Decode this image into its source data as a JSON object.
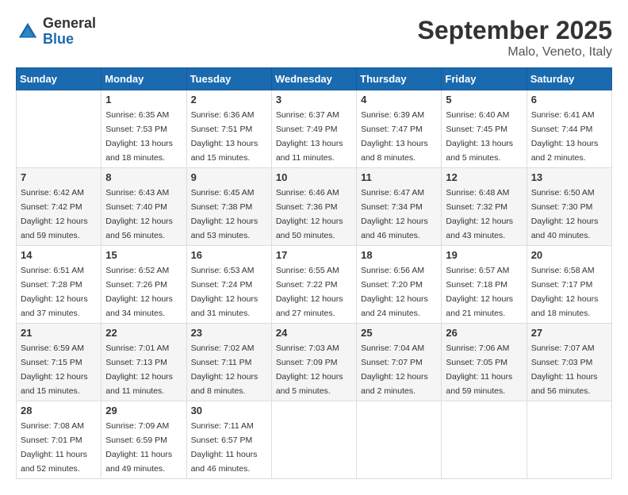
{
  "logo": {
    "general": "General",
    "blue": "Blue"
  },
  "title": "September 2025",
  "subtitle": "Malo, Veneto, Italy",
  "weekdays": [
    "Sunday",
    "Monday",
    "Tuesday",
    "Wednesday",
    "Thursday",
    "Friday",
    "Saturday"
  ],
  "weeks": [
    [
      {
        "day": "",
        "info": ""
      },
      {
        "day": "1",
        "info": "Sunrise: 6:35 AM\nSunset: 7:53 PM\nDaylight: 13 hours\nand 18 minutes."
      },
      {
        "day": "2",
        "info": "Sunrise: 6:36 AM\nSunset: 7:51 PM\nDaylight: 13 hours\nand 15 minutes."
      },
      {
        "day": "3",
        "info": "Sunrise: 6:37 AM\nSunset: 7:49 PM\nDaylight: 13 hours\nand 11 minutes."
      },
      {
        "day": "4",
        "info": "Sunrise: 6:39 AM\nSunset: 7:47 PM\nDaylight: 13 hours\nand 8 minutes."
      },
      {
        "day": "5",
        "info": "Sunrise: 6:40 AM\nSunset: 7:45 PM\nDaylight: 13 hours\nand 5 minutes."
      },
      {
        "day": "6",
        "info": "Sunrise: 6:41 AM\nSunset: 7:44 PM\nDaylight: 13 hours\nand 2 minutes."
      }
    ],
    [
      {
        "day": "7",
        "info": "Sunrise: 6:42 AM\nSunset: 7:42 PM\nDaylight: 12 hours\nand 59 minutes."
      },
      {
        "day": "8",
        "info": "Sunrise: 6:43 AM\nSunset: 7:40 PM\nDaylight: 12 hours\nand 56 minutes."
      },
      {
        "day": "9",
        "info": "Sunrise: 6:45 AM\nSunset: 7:38 PM\nDaylight: 12 hours\nand 53 minutes."
      },
      {
        "day": "10",
        "info": "Sunrise: 6:46 AM\nSunset: 7:36 PM\nDaylight: 12 hours\nand 50 minutes."
      },
      {
        "day": "11",
        "info": "Sunrise: 6:47 AM\nSunset: 7:34 PM\nDaylight: 12 hours\nand 46 minutes."
      },
      {
        "day": "12",
        "info": "Sunrise: 6:48 AM\nSunset: 7:32 PM\nDaylight: 12 hours\nand 43 minutes."
      },
      {
        "day": "13",
        "info": "Sunrise: 6:50 AM\nSunset: 7:30 PM\nDaylight: 12 hours\nand 40 minutes."
      }
    ],
    [
      {
        "day": "14",
        "info": "Sunrise: 6:51 AM\nSunset: 7:28 PM\nDaylight: 12 hours\nand 37 minutes."
      },
      {
        "day": "15",
        "info": "Sunrise: 6:52 AM\nSunset: 7:26 PM\nDaylight: 12 hours\nand 34 minutes."
      },
      {
        "day": "16",
        "info": "Sunrise: 6:53 AM\nSunset: 7:24 PM\nDaylight: 12 hours\nand 31 minutes."
      },
      {
        "day": "17",
        "info": "Sunrise: 6:55 AM\nSunset: 7:22 PM\nDaylight: 12 hours\nand 27 minutes."
      },
      {
        "day": "18",
        "info": "Sunrise: 6:56 AM\nSunset: 7:20 PM\nDaylight: 12 hours\nand 24 minutes."
      },
      {
        "day": "19",
        "info": "Sunrise: 6:57 AM\nSunset: 7:18 PM\nDaylight: 12 hours\nand 21 minutes."
      },
      {
        "day": "20",
        "info": "Sunrise: 6:58 AM\nSunset: 7:17 PM\nDaylight: 12 hours\nand 18 minutes."
      }
    ],
    [
      {
        "day": "21",
        "info": "Sunrise: 6:59 AM\nSunset: 7:15 PM\nDaylight: 12 hours\nand 15 minutes."
      },
      {
        "day": "22",
        "info": "Sunrise: 7:01 AM\nSunset: 7:13 PM\nDaylight: 12 hours\nand 11 minutes."
      },
      {
        "day": "23",
        "info": "Sunrise: 7:02 AM\nSunset: 7:11 PM\nDaylight: 12 hours\nand 8 minutes."
      },
      {
        "day": "24",
        "info": "Sunrise: 7:03 AM\nSunset: 7:09 PM\nDaylight: 12 hours\nand 5 minutes."
      },
      {
        "day": "25",
        "info": "Sunrise: 7:04 AM\nSunset: 7:07 PM\nDaylight: 12 hours\nand 2 minutes."
      },
      {
        "day": "26",
        "info": "Sunrise: 7:06 AM\nSunset: 7:05 PM\nDaylight: 11 hours\nand 59 minutes."
      },
      {
        "day": "27",
        "info": "Sunrise: 7:07 AM\nSunset: 7:03 PM\nDaylight: 11 hours\nand 56 minutes."
      }
    ],
    [
      {
        "day": "28",
        "info": "Sunrise: 7:08 AM\nSunset: 7:01 PM\nDaylight: 11 hours\nand 52 minutes."
      },
      {
        "day": "29",
        "info": "Sunrise: 7:09 AM\nSunset: 6:59 PM\nDaylight: 11 hours\nand 49 minutes."
      },
      {
        "day": "30",
        "info": "Sunrise: 7:11 AM\nSunset: 6:57 PM\nDaylight: 11 hours\nand 46 minutes."
      },
      {
        "day": "",
        "info": ""
      },
      {
        "day": "",
        "info": ""
      },
      {
        "day": "",
        "info": ""
      },
      {
        "day": "",
        "info": ""
      }
    ]
  ]
}
